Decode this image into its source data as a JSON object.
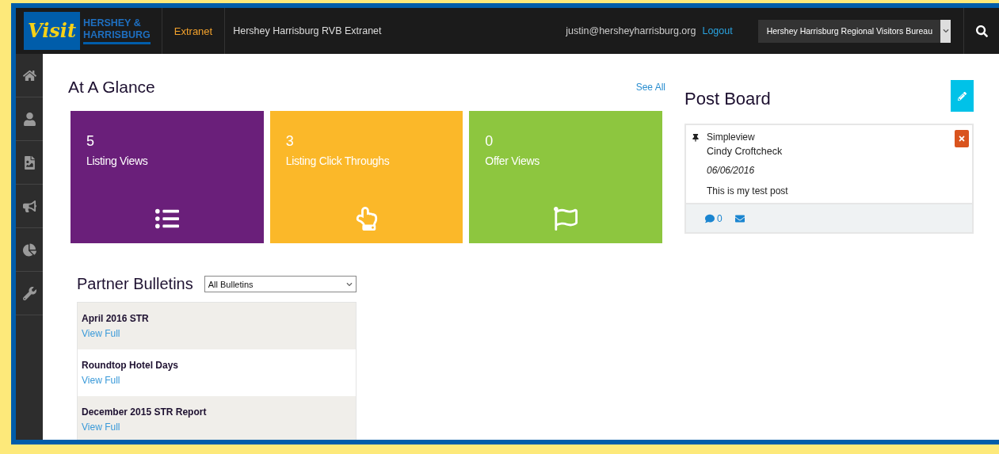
{
  "header": {
    "logo": {
      "script": "Visit",
      "line_1": "HERSHEY &",
      "line_2": "HARRISBURG"
    },
    "section": "Extranet",
    "title": "Hershey Harrisburg RVB Extranet",
    "user_email": "justin@hersheyharrisburg.org",
    "logout": "Logout",
    "organization_select": "Hershey Harrisburg Regional Visitors Bureau"
  },
  "at_a_glance": {
    "title": "At A Glance",
    "see_all": "See All",
    "tiles": [
      {
        "value": "5",
        "label": "Listing Views",
        "color": "#6a1f7a"
      },
      {
        "value": "3",
        "label": "Listing Click Throughs",
        "color": "#fbb829"
      },
      {
        "value": "0",
        "label": "Offer Views",
        "color": "#8dc63f"
      }
    ]
  },
  "post_board": {
    "title": "Post Board",
    "posts": [
      {
        "source": "Simpleview",
        "author": "Cindy Croftcheck",
        "date": "06/06/2016",
        "text": "This is my test post",
        "comment_count": "0"
      }
    ]
  },
  "partner_bulletins": {
    "title": "Partner Bulletins",
    "filter": "All Bulletins",
    "items": [
      {
        "title": "April 2016 STR",
        "link": "View Full"
      },
      {
        "title": "Roundtop Hotel Days",
        "link": "View Full"
      },
      {
        "title": "December 2015 STR Report",
        "link": "View Full"
      }
    ]
  }
}
